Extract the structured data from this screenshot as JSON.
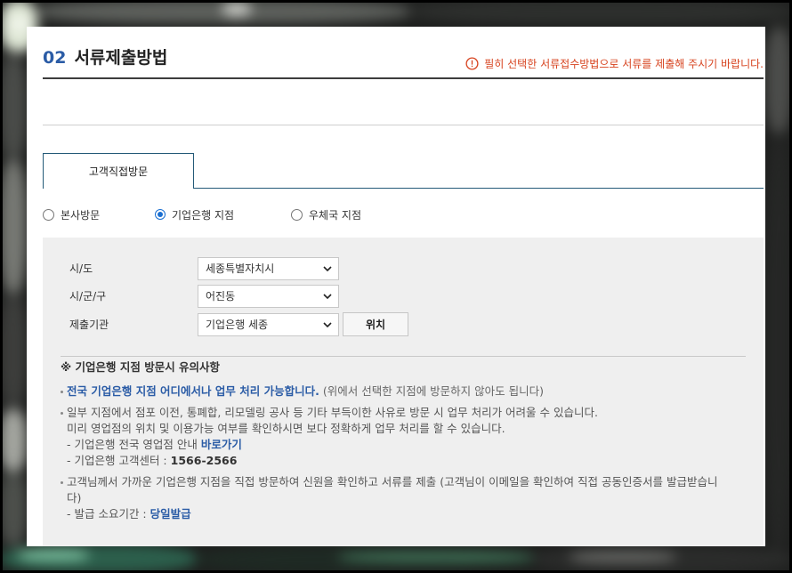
{
  "section": {
    "number": "02",
    "title": "서류제출방법",
    "notice": "필히 선택한 서류접수방법으로 서류를 제출해 주시기 바랍니다.",
    "notice_icon": "alert-circle-icon"
  },
  "tabs": [
    {
      "label": "고객직접방문",
      "active": true
    }
  ],
  "radios": [
    {
      "label": "본사방문",
      "selected": false
    },
    {
      "label": "기업은행 지점",
      "selected": true
    },
    {
      "label": "우체국 지점",
      "selected": false
    }
  ],
  "form": {
    "rows": [
      {
        "label": "시/도",
        "value": "세종특별자치시"
      },
      {
        "label": "시/군/구",
        "value": "어진동"
      },
      {
        "label": "제출기관",
        "value": "기업은행 세종"
      }
    ],
    "location_button": "위치",
    "select_icon": "chevron-down-icon"
  },
  "guide": {
    "heading": "※ 기업은행 지점 방문시 유의사항",
    "items": [
      {
        "strong": "전국 기업은행 지점 어디에서나 업무 처리 가능합니다.",
        "note": "(위에서 선택한 지점에 방문하지 않아도 됩니다)"
      },
      {
        "lines": [
          "일부 지점에서 점포 이전, 통폐합, 리모델링 공사 등 기타 부득이한 사유로 방문 시 업무 처리가 어려울 수 있습니다.",
          "미리 영업점의 위치 및 이용가능 여부를 확인하시면 보다 정확하게 업무 처리를 할 수 있습니다."
        ],
        "subs": [
          {
            "text": "- 기업은행 전국 영업점 안내",
            "link": "바로가기"
          },
          {
            "text": "- 기업은행 고객센터 :",
            "strong": "1566-2566"
          }
        ]
      },
      {
        "lines": [
          "고객님께서 가까운 기업은행 지점을 직접 방문하여 신원을 확인하고 서류를 제출 (고객님이 이메일을 확인하여 직접 공동인증서를 발급받습니",
          "다)"
        ],
        "subs": [
          {
            "text": "- 발급 소요기간 :",
            "strong": "당일발급"
          }
        ]
      }
    ]
  },
  "colors": {
    "accent": "#2b5ca6",
    "notice": "#d7431f",
    "tab": "#245a78",
    "radio": "#1a6fd1"
  }
}
